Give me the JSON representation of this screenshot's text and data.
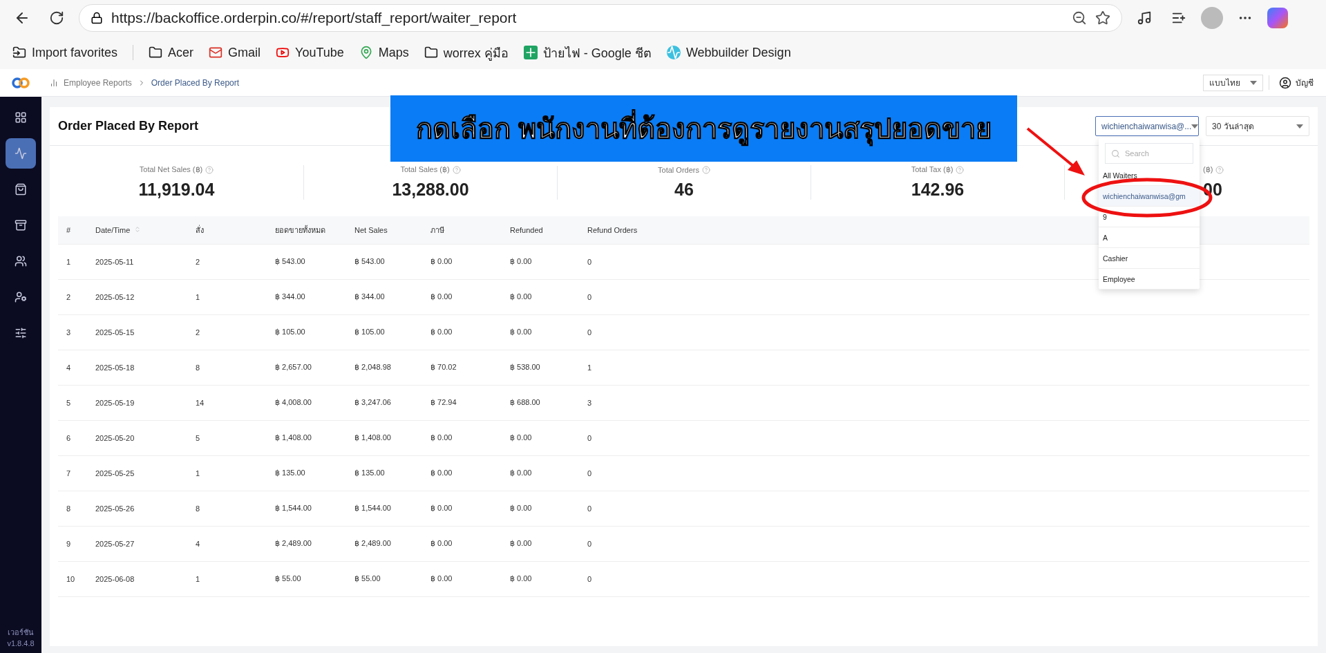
{
  "browser": {
    "url": "https://backoffice.orderpin.co/#/report/staff_report/waiter_report",
    "bookmarks": [
      {
        "kind": "import",
        "label": "Import favorites"
      },
      {
        "kind": "folder",
        "label": "Acer"
      },
      {
        "kind": "mail",
        "label": "Gmail"
      },
      {
        "kind": "video",
        "label": "YouTube"
      },
      {
        "kind": "map",
        "label": "Maps"
      },
      {
        "kind": "folder",
        "label": "worrex คู่มือ"
      },
      {
        "kind": "sheet",
        "label": "ป้ายไฟ - Google ชีต"
      },
      {
        "kind": "site",
        "label": "Webbuilder Design"
      }
    ]
  },
  "header": {
    "breadcrumb": [
      "Employee Reports",
      "Order Placed By Report"
    ],
    "language": "แบบไทย",
    "account": "บัญชี"
  },
  "sidebar": {
    "items": [
      {
        "selected": false
      },
      {
        "selected": true
      },
      {
        "selected": false
      },
      {
        "selected": false
      },
      {
        "selected": false
      },
      {
        "selected": false
      },
      {
        "selected": false
      }
    ],
    "version_label": "เวอร์ชัน",
    "version": "v1.8.4.8"
  },
  "report": {
    "title": "Order Placed By Report",
    "waiter_select": "wichienchaiwanwisa@...",
    "period_select": "30 วันล่าสุด",
    "waiter_menu": {
      "search_placeholder": "Search",
      "options": [
        {
          "label": "All Waiters",
          "selected": false
        },
        {
          "label": "wichienchaiwanwisa@gm",
          "selected": true
        },
        {
          "label": "9",
          "selected": false
        },
        {
          "label": "A",
          "selected": false
        },
        {
          "label": "Cashier",
          "selected": false
        },
        {
          "label": "Employee",
          "selected": false
        }
      ]
    },
    "stats": [
      {
        "label": "Total Net Sales (฿)",
        "value": "11,919.04"
      },
      {
        "label": "Total Sales (฿)",
        "value": "13,288.00"
      },
      {
        "label": "Total Orders",
        "value": "46"
      },
      {
        "label": "Total Tax (฿)",
        "value": "142.96"
      },
      {
        "label": "(฿)",
        "value": "00"
      }
    ],
    "table": {
      "columns": [
        "#",
        "Date/Time",
        "สั่ง",
        "ยอดขายทั้งหมด",
        "Net Sales",
        "ภาษี",
        "Refunded",
        "Refund Orders"
      ],
      "rows": [
        [
          "1",
          "2025-05-11",
          "2",
          "฿ 543.00",
          "฿ 543.00",
          "฿ 0.00",
          "฿ 0.00",
          "0"
        ],
        [
          "2",
          "2025-05-12",
          "1",
          "฿ 344.00",
          "฿ 344.00",
          "฿ 0.00",
          "฿ 0.00",
          "0"
        ],
        [
          "3",
          "2025-05-15",
          "2",
          "฿ 105.00",
          "฿ 105.00",
          "฿ 0.00",
          "฿ 0.00",
          "0"
        ],
        [
          "4",
          "2025-05-18",
          "8",
          "฿ 2,657.00",
          "฿ 2,048.98",
          "฿ 70.02",
          "฿ 538.00",
          "1"
        ],
        [
          "5",
          "2025-05-19",
          "14",
          "฿ 4,008.00",
          "฿ 3,247.06",
          "฿ 72.94",
          "฿ 688.00",
          "3"
        ],
        [
          "6",
          "2025-05-20",
          "5",
          "฿ 1,408.00",
          "฿ 1,408.00",
          "฿ 0.00",
          "฿ 0.00",
          "0"
        ],
        [
          "7",
          "2025-05-25",
          "1",
          "฿ 135.00",
          "฿ 135.00",
          "฿ 0.00",
          "฿ 0.00",
          "0"
        ],
        [
          "8",
          "2025-05-26",
          "8",
          "฿ 1,544.00",
          "฿ 1,544.00",
          "฿ 0.00",
          "฿ 0.00",
          "0"
        ],
        [
          "9",
          "2025-05-27",
          "4",
          "฿ 2,489.00",
          "฿ 2,489.00",
          "฿ 0.00",
          "฿ 0.00",
          "0"
        ],
        [
          "10",
          "2025-06-08",
          "1",
          "฿ 55.00",
          "฿ 55.00",
          "฿ 0.00",
          "฿ 0.00",
          "0"
        ]
      ]
    }
  },
  "annotation": {
    "banner": "กดเลือก พนักงานที่ต้องการดูรายงานสรุปยอดขาย"
  }
}
